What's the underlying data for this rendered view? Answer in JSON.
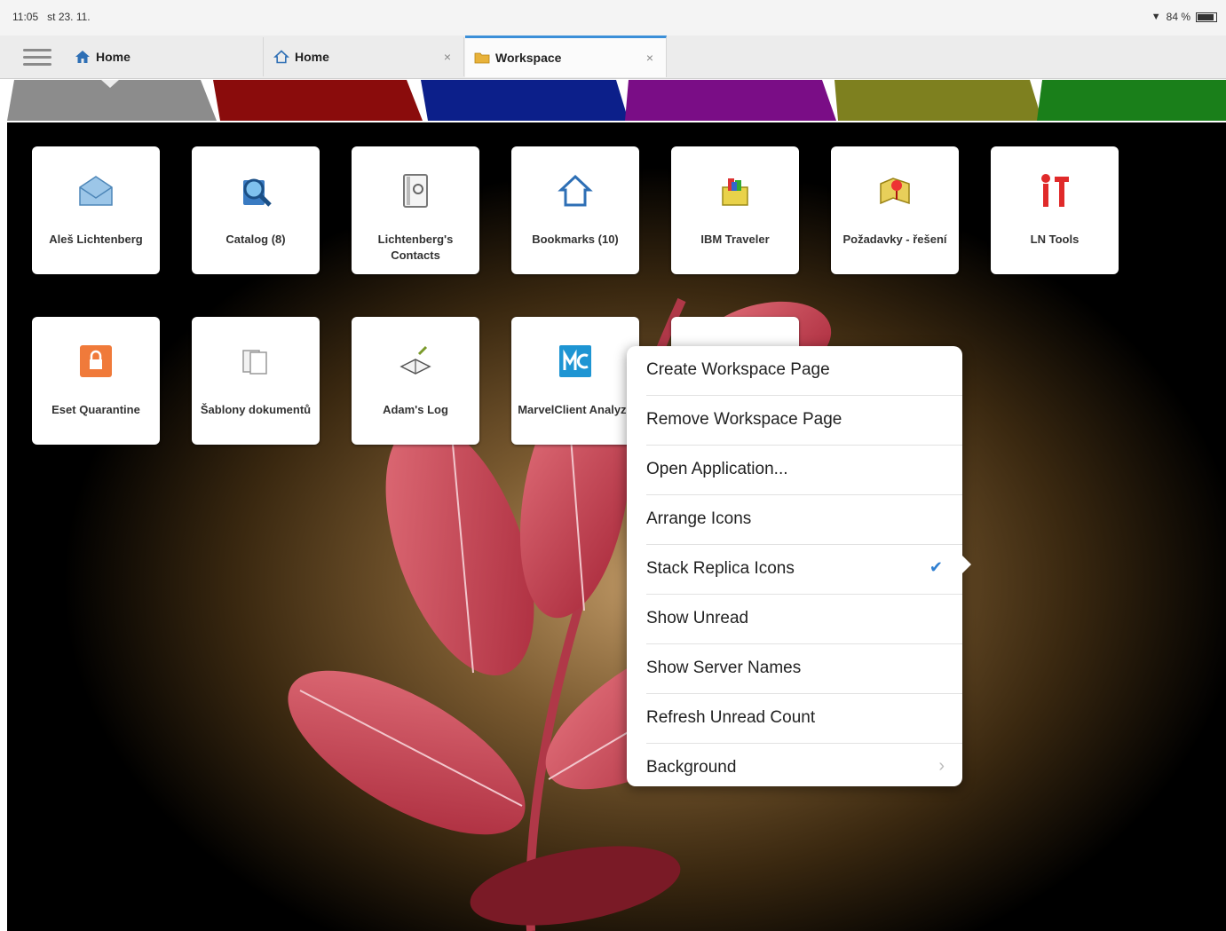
{
  "status": {
    "time": "11:05",
    "date": "st 23. 11.",
    "battery": "84 %"
  },
  "tabs": [
    {
      "label": "Home",
      "icon": "home-filled-icon",
      "closable": false
    },
    {
      "label": "Home",
      "icon": "home-outline-icon",
      "closable": true
    },
    {
      "label": "Workspace",
      "icon": "folder-icon",
      "closable": true,
      "active": true
    }
  ],
  "tab_close_symbol": "×",
  "color_strip": [
    "#8c8c8c",
    "#8a0c0c",
    "#0c1f8a",
    "#7a0d86",
    "#7e801f",
    "#1a7f1a"
  ],
  "tiles": [
    {
      "label": "Aleš Lichtenberg",
      "icon": "mail-icon"
    },
    {
      "label": "Catalog (8)",
      "icon": "catalog-search-icon"
    },
    {
      "label": "Lichtenberg's Contacts",
      "icon": "contacts-icon"
    },
    {
      "label": "Bookmarks (10)",
      "icon": "home-icon"
    },
    {
      "label": "IBM Traveler",
      "icon": "traveler-icon"
    },
    {
      "label": "Požadavky - řešení",
      "icon": "map-pin-icon"
    },
    {
      "label": "LN Tools",
      "icon": "tools-icon"
    },
    {
      "label": "Eset Quarantine",
      "icon": "lock-icon"
    },
    {
      "label": "Šablony dokumentů",
      "icon": "templates-icon"
    },
    {
      "label": "Adam's Log",
      "icon": "book-icon"
    },
    {
      "label": "MarvelClient Analyze",
      "icon": "marvelclient-icon"
    }
  ],
  "menu": {
    "items": [
      {
        "label": "Create Workspace Page"
      },
      {
        "label": "Remove Workspace Page"
      },
      {
        "label": "Open Application..."
      },
      {
        "label": "Arrange Icons"
      },
      {
        "label": "Stack Replica Icons",
        "checked": true
      },
      {
        "label": "Show Unread"
      },
      {
        "label": "Show Server Names"
      },
      {
        "label": "Refresh Unread Count"
      },
      {
        "label": "Background",
        "submenu": true
      }
    ],
    "check_symbol": "✔",
    "submenu_symbol": "›"
  }
}
